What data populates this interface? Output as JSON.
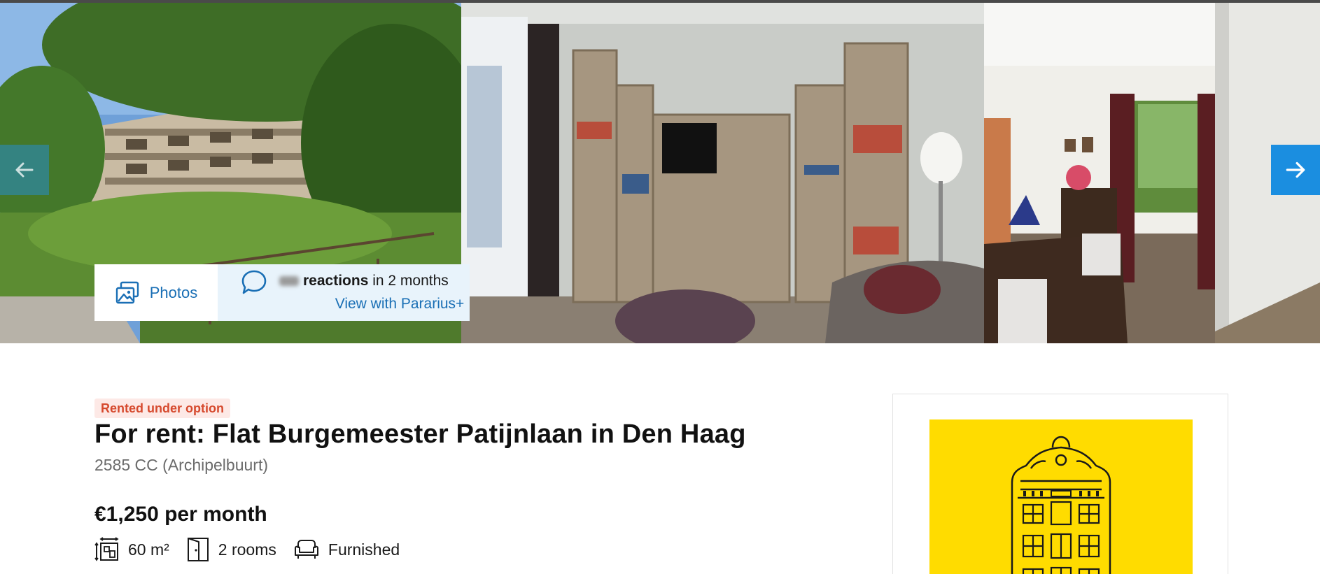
{
  "gallery": {
    "photos_label": "Photos",
    "reactions_label": "reactions",
    "reactions_period": "in 2 months",
    "pararius_plus_label": "View with Pararius+",
    "prev_icon": "arrow-left-icon",
    "next_icon": "arrow-right-icon"
  },
  "listing": {
    "status": "Rented under option",
    "title": "For rent: Flat Burgemeester Patijnlaan in Den Haag",
    "location": "2585 CC (Archipelbuurt)",
    "price": "€1,250 per month",
    "features": [
      {
        "icon": "surface-area-icon",
        "label": "60 m²"
      },
      {
        "icon": "door-icon",
        "label": "2 rooms"
      },
      {
        "icon": "armchair-icon",
        "label": "Furnished"
      }
    ]
  },
  "colors": {
    "accent": "#1b8ee0",
    "link": "#1a6fb5",
    "status": "#d64a2e",
    "agent_logo_bg": "#ffdc00"
  }
}
